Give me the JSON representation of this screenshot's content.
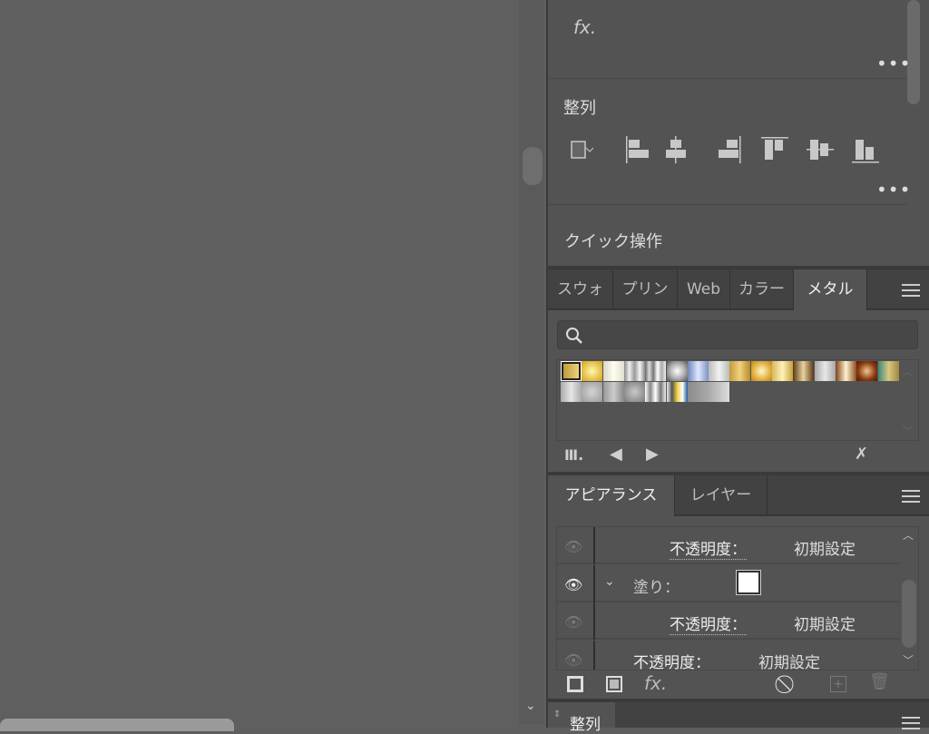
{
  "top_section": {
    "fx_label": "fx.",
    "more": "•••"
  },
  "align_section": {
    "title": "整列",
    "more": "•••"
  },
  "quick_actions": {
    "title": "クイック操作"
  },
  "swatch_panel": {
    "tabs": [
      "スウォ",
      "プリン",
      "Web",
      "カラー",
      "メタル"
    ],
    "active_tab": "メタル",
    "search_placeholder": "",
    "swatches_row1": [
      "linear-gradient(90deg,#b8902c,#f3dd8c)",
      "radial-gradient(circle,#fff6a8,#d4a21a)",
      "linear-gradient(90deg,#dcd8c4,#fffdf2,#e2dfcc)",
      "linear-gradient(90deg,#8a8a8a,#eee,#999,#f4f4f4,#888)",
      "linear-gradient(90deg,#666,#ddd,#777,#fff,#aaa,#eee)",
      "radial-gradient(circle,#fff,#aaa 55%,#555)",
      "linear-gradient(90deg,#6d86b8,#dfe8ff,#7d92c4)",
      "linear-gradient(90deg,#bbb,#f2f2f2,#bbb)",
      "linear-gradient(90deg,#c49a38,#f0d27e,#b88a2a)",
      "radial-gradient(circle,#fff8c8,#e2b040 60%,#b8861e)",
      "linear-gradient(90deg,#d8b860,#fff2b8,#c8a040)",
      "linear-gradient(90deg,#5a3a14,#e8d2a0,#5a3a14)",
      "linear-gradient(90deg,#a8a8a8,#e8e8e8,#a8a8a8)",
      "linear-gradient(90deg,#7a4418,#fff2d0,#8a5020)",
      "radial-gradient(circle,#f0c890,#8a3a10 60%,#5a1208)",
      "linear-gradient(90deg,#3a8a7a,#d8c880,#a08840)"
    ],
    "swatches_row2": [
      "linear-gradient(90deg,#aaa,#e6e6e6,#aaa)",
      "radial-gradient(circle,#d4d4d4,#9a9a9a)",
      "linear-gradient(90deg,#999,#ccc,#888)",
      "radial-gradient(circle,#c8c8c8,#7a7a7a)",
      "linear-gradient(90deg,#fff,#888,#fff,#777,#eee)",
      "linear-gradient(90deg,#eee,#555,#f0d040,#fff,#1a5a9a)",
      "linear-gradient(90deg,#8a8a8a,#aaa)",
      "linear-gradient(90deg,#aaa,#ddd)"
    ]
  },
  "appearance_panel": {
    "tabs": [
      "アピアランス",
      "レイヤー"
    ],
    "rows": [
      {
        "label": "不透明度：",
        "value": "初期設定"
      },
      {
        "label": "塗り：",
        "value": ""
      },
      {
        "label": "不透明度：",
        "value": "初期設定"
      },
      {
        "label": "不透明度：",
        "value": "初期設定"
      }
    ],
    "fx_label": "fx."
  },
  "bottom_panel": {
    "title": "整列"
  },
  "colors": {
    "panel": "#535353",
    "tabbar": "#424242",
    "canvas": "#5f5f5f"
  }
}
